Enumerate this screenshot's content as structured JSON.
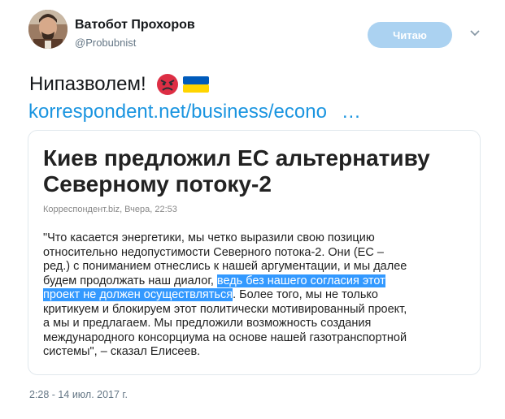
{
  "user": {
    "display_name": "Ватобот Прохоров",
    "handle": "@Probubnist"
  },
  "follow_button": {
    "label": "Читаю",
    "color": "#abd2f1"
  },
  "more_menu": {
    "icon": "chevron-down-icon"
  },
  "tweet": {
    "text": "Нипазволем!",
    "emojis": [
      "angry-face-emoji",
      "ukraine-flag-emoji"
    ],
    "link_text": "korrespondent.net/business/econo",
    "link_ellipsis": "…",
    "link_color": "#1b95e0",
    "timestamp": "2:28 - 14 июл. 2017 г."
  },
  "card": {
    "title": "Киев предложил ЕС альтернативу Северному потоку-2",
    "source": "Корреспондент.biz, Вчера, 22:53",
    "quote_before": "\"Что касается энергетики, мы четко выразили свою позицию\nотносительно недопустимости Северного потока-2. Они (ЕС –\nред.) с пониманием отнеслись к нашей аргументации, и мы далее\nбудем продолжать наш диалог, ",
    "quote_highlight_1": "ведь без нашего согласия этот",
    "quote_highlight_2": "проект не должен осуществляться",
    "quote_after": ". Более того, мы не только\nкритикуем и блокируем этот политически мотивированный проект,\nа мы и предлагаем. Мы предложили возможность создания\nмеждународного консорциума на основе нашей газотранспортной\nсистемы\", – сказал Елисеев."
  }
}
